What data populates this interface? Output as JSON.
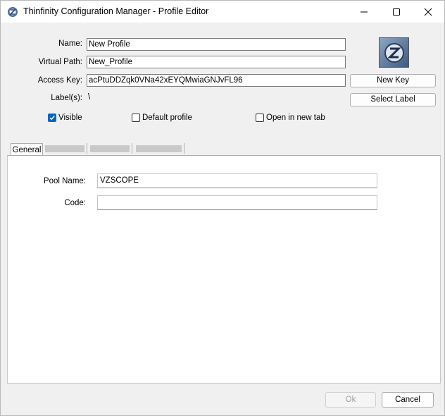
{
  "window": {
    "title": "Thinfinity Configuration Manager - Profile Editor"
  },
  "form": {
    "name_label": "Name:",
    "name_value": "New Profile",
    "vpath_label": "Virtual Path:",
    "vpath_value": "New_Profile",
    "key_label": "Access Key:",
    "key_value": "acPtuDDZqk0VNa42xEYQMwiaGNJvFL96",
    "labels_label": "Label(s):",
    "labels_value": "\\"
  },
  "buttons": {
    "new_key": "New Key",
    "select_label": "Select Label",
    "ok": "Ok",
    "cancel": "Cancel"
  },
  "checkboxes": {
    "visible": {
      "label": "Visible",
      "checked": true
    },
    "default_profile": {
      "label": "Default profile",
      "checked": false
    },
    "open_new_tab": {
      "label": "Open in new tab",
      "checked": false
    }
  },
  "tabs": {
    "general": "General"
  },
  "general_tab": {
    "pool_label": "Pool Name:",
    "pool_value": "VZSCOPE",
    "code_label": "Code:",
    "code_value": ""
  },
  "colors": {
    "accent": "#0067c0",
    "dialog_bg": "#f0f0f0"
  },
  "icons": [
    "thinfinity-app-icon",
    "minimize-icon",
    "maximize-icon",
    "close-icon",
    "profile-logo-icon",
    "checkmark-icon"
  ]
}
